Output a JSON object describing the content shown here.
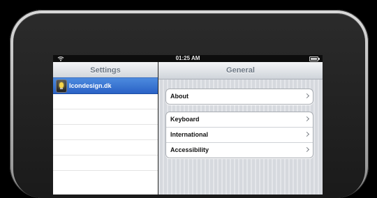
{
  "status_bar": {
    "time": "01:25 AM",
    "wifi_icon": "wifi-icon",
    "battery_icon": "battery-icon"
  },
  "master": {
    "title": "Settings",
    "items": [
      {
        "label": "Icondesign.dk",
        "icon": "lightbulb-icon",
        "selected": true
      }
    ]
  },
  "detail": {
    "title": "General",
    "groups": [
      {
        "cells": [
          {
            "label": "About"
          }
        ]
      },
      {
        "cells": [
          {
            "label": "Keyboard"
          },
          {
            "label": "International"
          },
          {
            "label": "Accessibility"
          }
        ]
      }
    ]
  },
  "colors": {
    "selection": "#2a62c6",
    "navbar_text": "#6c7784",
    "bezel": "#1a1a1a"
  }
}
